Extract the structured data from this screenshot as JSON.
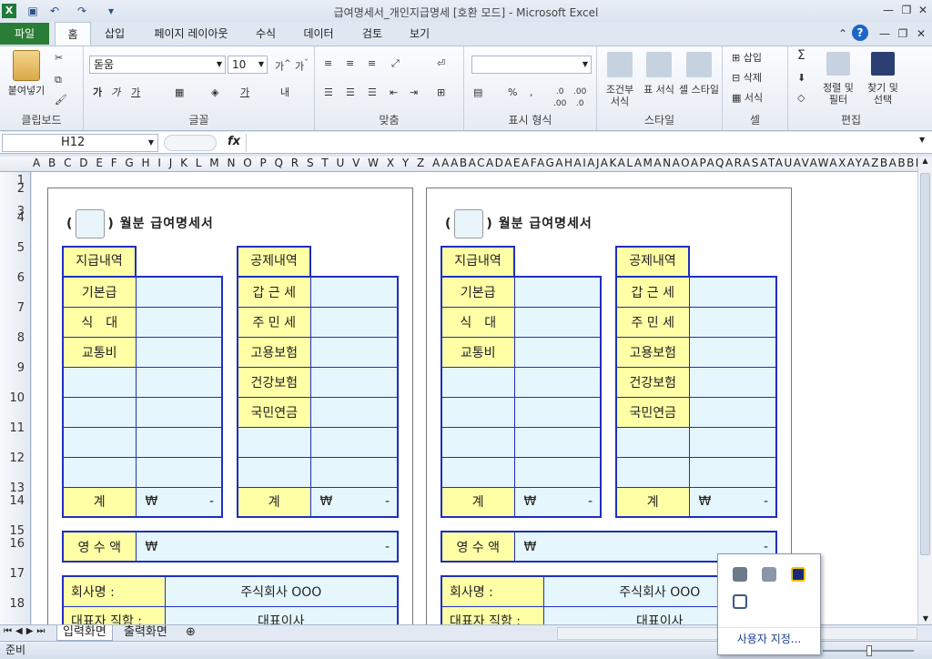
{
  "window": {
    "title": "급여명세서_개인지급명세  [호환 모드]  -  Microsoft Excel"
  },
  "tabs": [
    "파일",
    "홈",
    "삽입",
    "페이지 레이아웃",
    "수식",
    "데이터",
    "검토",
    "보기"
  ],
  "ribbon": {
    "clipboard": {
      "paste": "붙여넣기",
      "label": "클립보드"
    },
    "font": {
      "name": "돋움",
      "size": "10",
      "label": "글꼴",
      "bold": "가",
      "italic": "가",
      "underline": "가"
    },
    "align": {
      "wrap": "내",
      "label": "맞춤"
    },
    "number": {
      "format": "",
      "percent": "%",
      "comma": ",",
      "label": "표시 형식"
    },
    "styles": {
      "cond": "조건부 서식",
      "table": "표 서식",
      "cell": "셀 스타일",
      "label": "스타일"
    },
    "cells": {
      "insert": "삽입",
      "delete": "삭제",
      "format": "서식",
      "label": "셀"
    },
    "editing": {
      "sort": "정렬 및 필터",
      "find": "찾기 및 선택",
      "label": "편집",
      "sum": "Σ"
    }
  },
  "formula": {
    "namebox": "H12",
    "fx": "fx",
    "value": ""
  },
  "columns": "A B C D E F G H I J K L M N O P Q R S T U V W X Y Z AAABACADAEAFAGAHAIAJAKALAMANAOAPAQARASATAUAVAWAXAYAZBABBBCBDBEBFBGBHB",
  "rows": [
    "1",
    "2",
    "3",
    "4",
    "5",
    "6",
    "7",
    "8",
    "9",
    "10",
    "11",
    "12",
    "13",
    "14",
    "15",
    "16",
    "17",
    "18"
  ],
  "slip": {
    "title": "월분 급여명세서",
    "paren_open": "(",
    "paren_close": ")",
    "pay_header": "지급내역",
    "deduct_header": "공제내역",
    "pay_items": [
      "기본급",
      "식　대",
      "교통비",
      "",
      "",
      "",
      ""
    ],
    "deduct_items": [
      "갑 근 세",
      "주 민 세",
      "고용보험",
      "건강보험",
      "국민연금",
      "",
      ""
    ],
    "total_label": "계",
    "won": "₩",
    "dash": "-",
    "net_label": "영 수 액",
    "company_label": "회사명 :",
    "company_value": "주식회사 OOO",
    "rep_label": "대표자 직함 :",
    "rep_value": "대표이사"
  },
  "sheets": [
    "입력화면",
    "출력화면"
  ],
  "status": {
    "ready": "준비"
  },
  "popup": {
    "customize": "사용자 지정..."
  }
}
